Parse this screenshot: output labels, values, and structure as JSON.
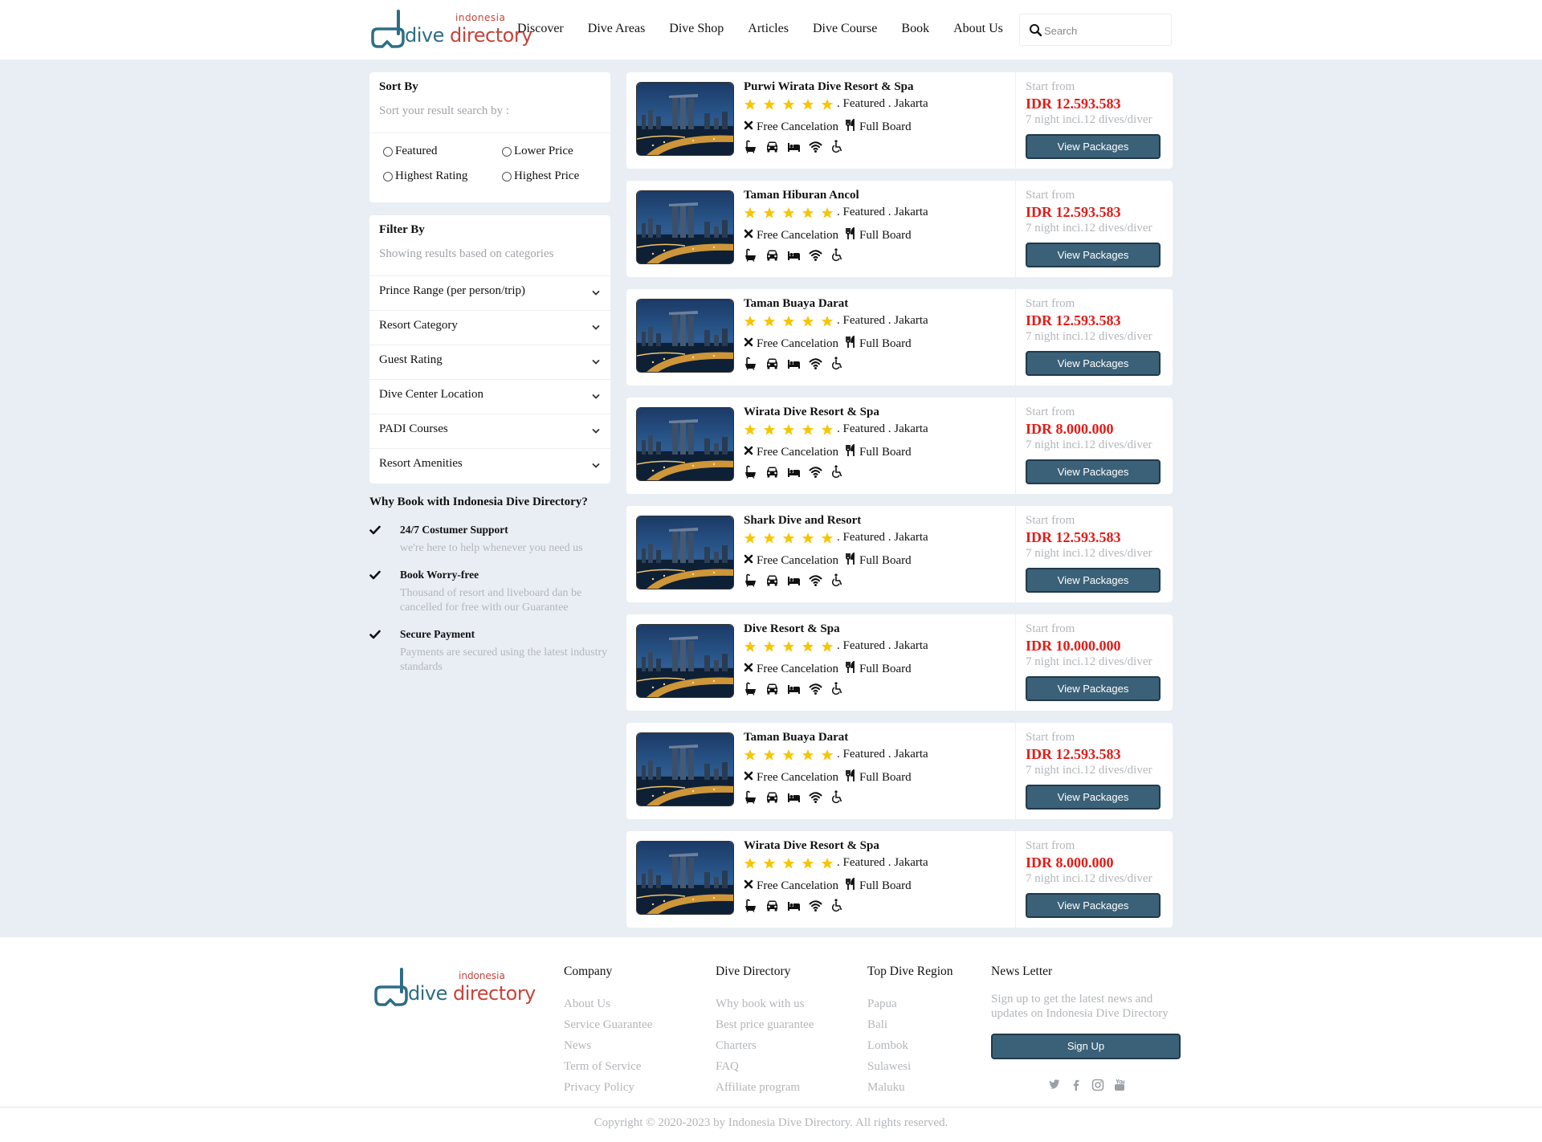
{
  "header": {
    "logo": {
      "tag": "indonesia",
      "name_part1": "dive",
      "name_part2": "directory"
    },
    "nav": [
      "Discover",
      "Dive Areas",
      "Dive Shop",
      "Articles",
      "Dive Course",
      "Book",
      "About Us"
    ],
    "search_placeholder": "Search"
  },
  "sort": {
    "title": "Sort By",
    "subtitle": "Sort your result search by :",
    "options": [
      "Featured",
      "Lower Price",
      "Highest Rating",
      "Highest Price"
    ]
  },
  "filter": {
    "title": "Filter By",
    "subtitle": "Showing results based on categories",
    "items": [
      "Prince Range (per person/trip)",
      "Resort Category",
      "Guest Rating",
      "Dive Center Location",
      "PADI Courses",
      "Resort Amenities"
    ]
  },
  "why": {
    "title": "Why Book with Indonesia Dive Directory?",
    "items": [
      {
        "title": "24/7 Costumer Support",
        "desc": "we're here to help whenever you need us"
      },
      {
        "title": "Book Worry-free",
        "desc": "Thousand of resort and liveboard dan be cancelled for free with our Guarantee"
      },
      {
        "title": "Secure Payment",
        "desc": "Payments are secured using the latest industry standards"
      }
    ]
  },
  "listings": [
    {
      "name": "Purwi Wirata Dive Resort & Spa",
      "stars": 5,
      "tag": "Featured",
      "location": "Jakarta",
      "feature1": "Free Cancelation",
      "feature2": "Full Board",
      "from": "Start from",
      "price": "IDR 12.593.583",
      "note": "7 night inci.12 dives/diver",
      "button": "View Packages"
    },
    {
      "name": "Taman Hiburan Ancol",
      "stars": 5,
      "tag": "Featured",
      "location": "Jakarta",
      "feature1": "Free Cancelation",
      "feature2": "Full Board",
      "from": "Start from",
      "price": "IDR 12.593.583",
      "note": "7 night inci.12 dives/diver",
      "button": "View Packages"
    },
    {
      "name": "Taman Buaya Darat",
      "stars": 5,
      "tag": "Featured",
      "location": "Jakarta",
      "feature1": "Free Cancelation",
      "feature2": "Full Board",
      "from": "Start from",
      "price": "IDR 12.593.583",
      "note": "7 night inci.12 dives/diver",
      "button": "View Packages"
    },
    {
      "name": "Wirata Dive Resort & Spa",
      "stars": 5,
      "tag": "Featured",
      "location": "Jakarta",
      "feature1": "Free Cancelation",
      "feature2": "Full Board",
      "from": "Start from",
      "price": "IDR 8.000.000",
      "note": "7 night inci.12 dives/diver",
      "button": "View Packages"
    },
    {
      "name": "Shark Dive and Resort",
      "stars": 5,
      "tag": "Featured",
      "location": "Jakarta",
      "feature1": "Free Cancelation",
      "feature2": "Full Board",
      "from": "Start from",
      "price": "IDR 12.593.583",
      "note": "7 night inci.12 dives/diver",
      "button": "View Packages"
    },
    {
      "name": "Dive Resort & Spa",
      "stars": 5,
      "tag": "Featured",
      "location": "Jakarta",
      "feature1": "Free Cancelation",
      "feature2": "Full Board",
      "from": "Start from",
      "price": "IDR 10.000.000",
      "note": "7 night inci.12 dives/diver",
      "button": "View Packages"
    },
    {
      "name": "Taman Buaya Darat",
      "stars": 5,
      "tag": "Featured",
      "location": "Jakarta",
      "feature1": "Free Cancelation",
      "feature2": "Full Board",
      "from": "Start from",
      "price": "IDR 12.593.583",
      "note": "7 night inci.12 dives/diver",
      "button": "View Packages"
    },
    {
      "name": "Wirata Dive Resort & Spa",
      "stars": 5,
      "tag": "Featured",
      "location": "Jakarta",
      "feature1": "Free Cancelation",
      "feature2": "Full Board",
      "from": "Start from",
      "price": "IDR 8.000.000",
      "note": "7 night inci.12 dives/diver",
      "button": "View Packages"
    }
  ],
  "amenity_icons": [
    "bathtub-icon",
    "car-icon",
    "bed-icon",
    "wifi-icon",
    "wheelchair-icon"
  ],
  "footer": {
    "company": {
      "title": "Company",
      "links": [
        "About Us",
        "Service Guarantee",
        "News",
        "Term of Service",
        "Privacy Policy"
      ]
    },
    "directory": {
      "title": "Dive Directory",
      "links": [
        "Why book with us",
        "Best price guarantee",
        "Charters",
        "FAQ",
        "Affiliate program"
      ]
    },
    "regions": {
      "title": "Top Dive Region",
      "links": [
        "Papua",
        "Bali",
        "Lombok",
        "Sulawesi",
        "Maluku"
      ]
    },
    "newsletter": {
      "title": "News Letter",
      "text": "Sign up to get the latest news and updates on Indonesia Dive Directory",
      "button": "Sign Up"
    },
    "social_icons": [
      "twitter-icon",
      "facebook-icon",
      "instagram-icon",
      "youtube-icon"
    ],
    "copyright": "Copyright © 2020-2023 by Indonesia Dive Directory. All rights reserved."
  },
  "colors": {
    "accent_button": "#3b6178",
    "price_red": "#e41b17",
    "page_bg": "#e9eef5",
    "star": "#f7c600",
    "logo_blue": "#2e6d86",
    "logo_red": "#c8433b"
  }
}
